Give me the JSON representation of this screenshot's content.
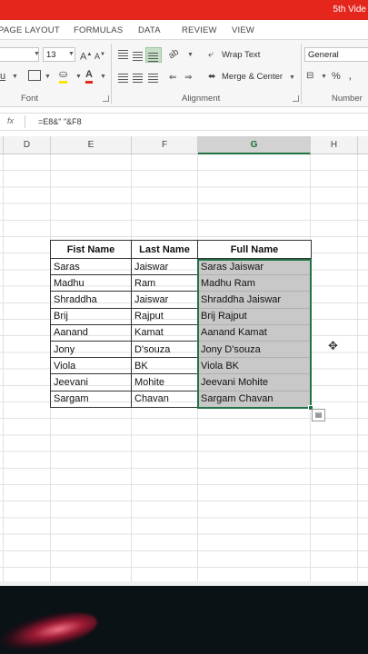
{
  "window": {
    "doc_title": "5th Vide"
  },
  "ribbon_tabs": [
    "PAGE LAYOUT",
    "FORMULAS",
    "DATA",
    "REVIEW",
    "VIEW"
  ],
  "font": {
    "size": "13",
    "group_label": "Font"
  },
  "alignment": {
    "wrap_text": "Wrap Text",
    "merge_center": "Merge & Center",
    "group_label": "Alignment"
  },
  "number": {
    "format": "General",
    "group_label": "Number",
    "percent": "%"
  },
  "formula_bar": {
    "fx": "fx",
    "formula": "=E8&\" \"&F8"
  },
  "columns": [
    "D",
    "E",
    "F",
    "G",
    "H"
  ],
  "selected_column": "G",
  "table": {
    "headers": [
      "Fist Name",
      "Last Name",
      "Full Name"
    ],
    "rows": [
      [
        "Saras",
        "Jaiswar",
        "Saras Jaiswar"
      ],
      [
        "Madhu",
        "Ram",
        "Madhu Ram"
      ],
      [
        "Shraddha",
        "Jaiswar",
        "Shraddha Jaiswar"
      ],
      [
        "Brij",
        "Rajput",
        "Brij Rajput"
      ],
      [
        "Aanand",
        "Kamat",
        "Aanand Kamat"
      ],
      [
        "Jony",
        "D'souza",
        "Jony D'souza"
      ],
      [
        "Viola",
        "BK",
        "Viola BK"
      ],
      [
        "Jeevani",
        "Mohite",
        "Jeevani Mohite"
      ],
      [
        "Sargam",
        "Chavan",
        "Sargam Chavan"
      ]
    ]
  },
  "colors": {
    "title_bar": "#e5261c",
    "selection": "#217346",
    "filled_cell": "#c8c8c8"
  }
}
